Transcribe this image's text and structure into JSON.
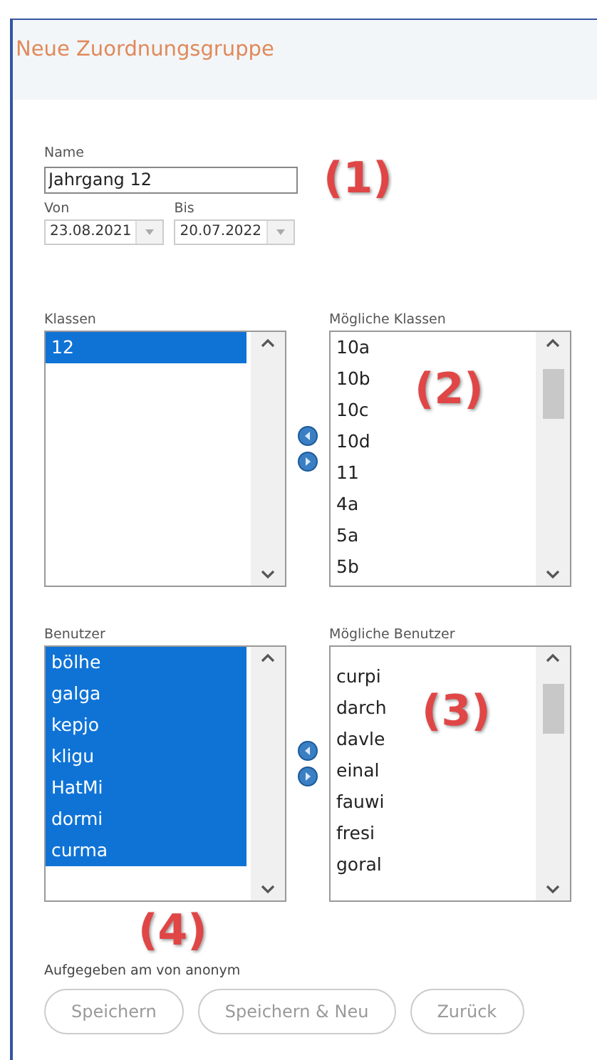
{
  "window": {
    "title": "Neue Zuordnungsgruppe"
  },
  "name_field": {
    "label": "Name",
    "value": "Jahrgang 12"
  },
  "date_fields": [
    {
      "label": "Von",
      "value": "23.08.2021"
    },
    {
      "label": "Bis",
      "value": "20.07.2022"
    }
  ],
  "classes": {
    "label": "Klassen",
    "items": [
      {
        "text": "12",
        "selected": true
      }
    ],
    "available_label": "Mögliche Klassen",
    "available": [
      {
        "text": "10a",
        "selected": false
      },
      {
        "text": "10b",
        "selected": false
      },
      {
        "text": "10c",
        "selected": false
      },
      {
        "text": "10d",
        "selected": false
      },
      {
        "text": "11",
        "selected": false
      },
      {
        "text": "4a",
        "selected": false
      },
      {
        "text": "5a",
        "selected": false
      },
      {
        "text": "5b",
        "selected": false
      }
    ]
  },
  "users": {
    "label": "Benutzer",
    "items": [
      {
        "text": "bölhe",
        "selected": true
      },
      {
        "text": "galga",
        "selected": true
      },
      {
        "text": "kepjo",
        "selected": true
      },
      {
        "text": "kligu",
        "selected": true
      },
      {
        "text": "HatMi",
        "selected": true
      },
      {
        "text": "dormi",
        "selected": true
      },
      {
        "text": "curma",
        "selected": true
      }
    ],
    "available_label": "Mögliche Benutzer",
    "available": [
      {
        "text": "curpi",
        "selected": false
      },
      {
        "text": "darch",
        "selected": false
      },
      {
        "text": "davle",
        "selected": false
      },
      {
        "text": "einal",
        "selected": false
      },
      {
        "text": "fauwi",
        "selected": false
      },
      {
        "text": "fresi",
        "selected": false
      },
      {
        "text": "goral",
        "selected": false
      }
    ]
  },
  "footer_text": "Aufgegeben am  von anonym",
  "buttons": [
    {
      "label": "Speichern",
      "disabled": true
    },
    {
      "label": "Speichern & Neu",
      "disabled": true
    },
    {
      "label": "Zurück",
      "disabled": true
    }
  ],
  "callouts": [
    "(1)",
    "(2)",
    "(3)",
    "(4)"
  ]
}
